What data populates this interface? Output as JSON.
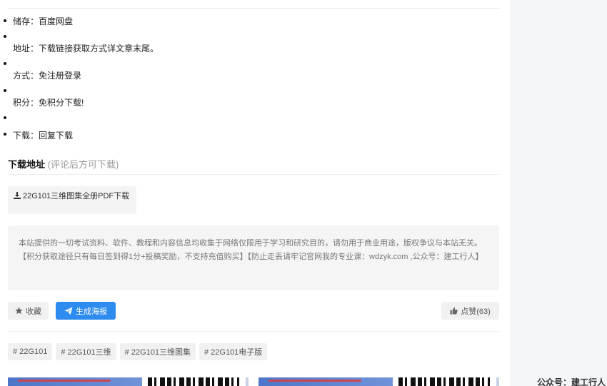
{
  "info_list": [
    {
      "label": "储存：百度网盘"
    },
    {
      "label": ""
    },
    {
      "label": "地址：下载链接获取方式详文章末尾。"
    },
    {
      "label": ""
    },
    {
      "label": "方式：免注册登录"
    },
    {
      "label": ""
    },
    {
      "label": "积分：免积分下载!"
    },
    {
      "label": ""
    },
    {
      "label": "下载：回复下载"
    }
  ],
  "download": {
    "heading": "下载地址",
    "note": "(评论后方可下载)",
    "link_label": "22G101三维图集全册PDF下载",
    "link_icon": "download-icon"
  },
  "notice": {
    "text": "本站提供的一切考试资料、软件、教程和内容信息均收集于网络仅限用于学习和研究目的，请勿用于商业用途，版权争议与本站无关。【积分获取途径只有每日签到得1分+投稿奖励，不支持充值购买】【防止走丢请牢记官网我的专业课：wdzyk.com ,公众号：建工行人】"
  },
  "actions": {
    "favorite_label": "收藏",
    "favorite_icon": "star-icon",
    "poster_label": "生成海报",
    "poster_icon": "paper-plane-icon",
    "like_label": "点赞(63)",
    "like_icon": "thumbs-up-icon",
    "accent_color": "#2e8cf0"
  },
  "tags": [
    {
      "label": "# 22G101"
    },
    {
      "label": "# 22G101三维"
    },
    {
      "label": "# 22G101三维图集"
    },
    {
      "label": "# 22G101电子版"
    }
  ],
  "sidebar": {
    "caption": "公众号：建工行人"
  }
}
